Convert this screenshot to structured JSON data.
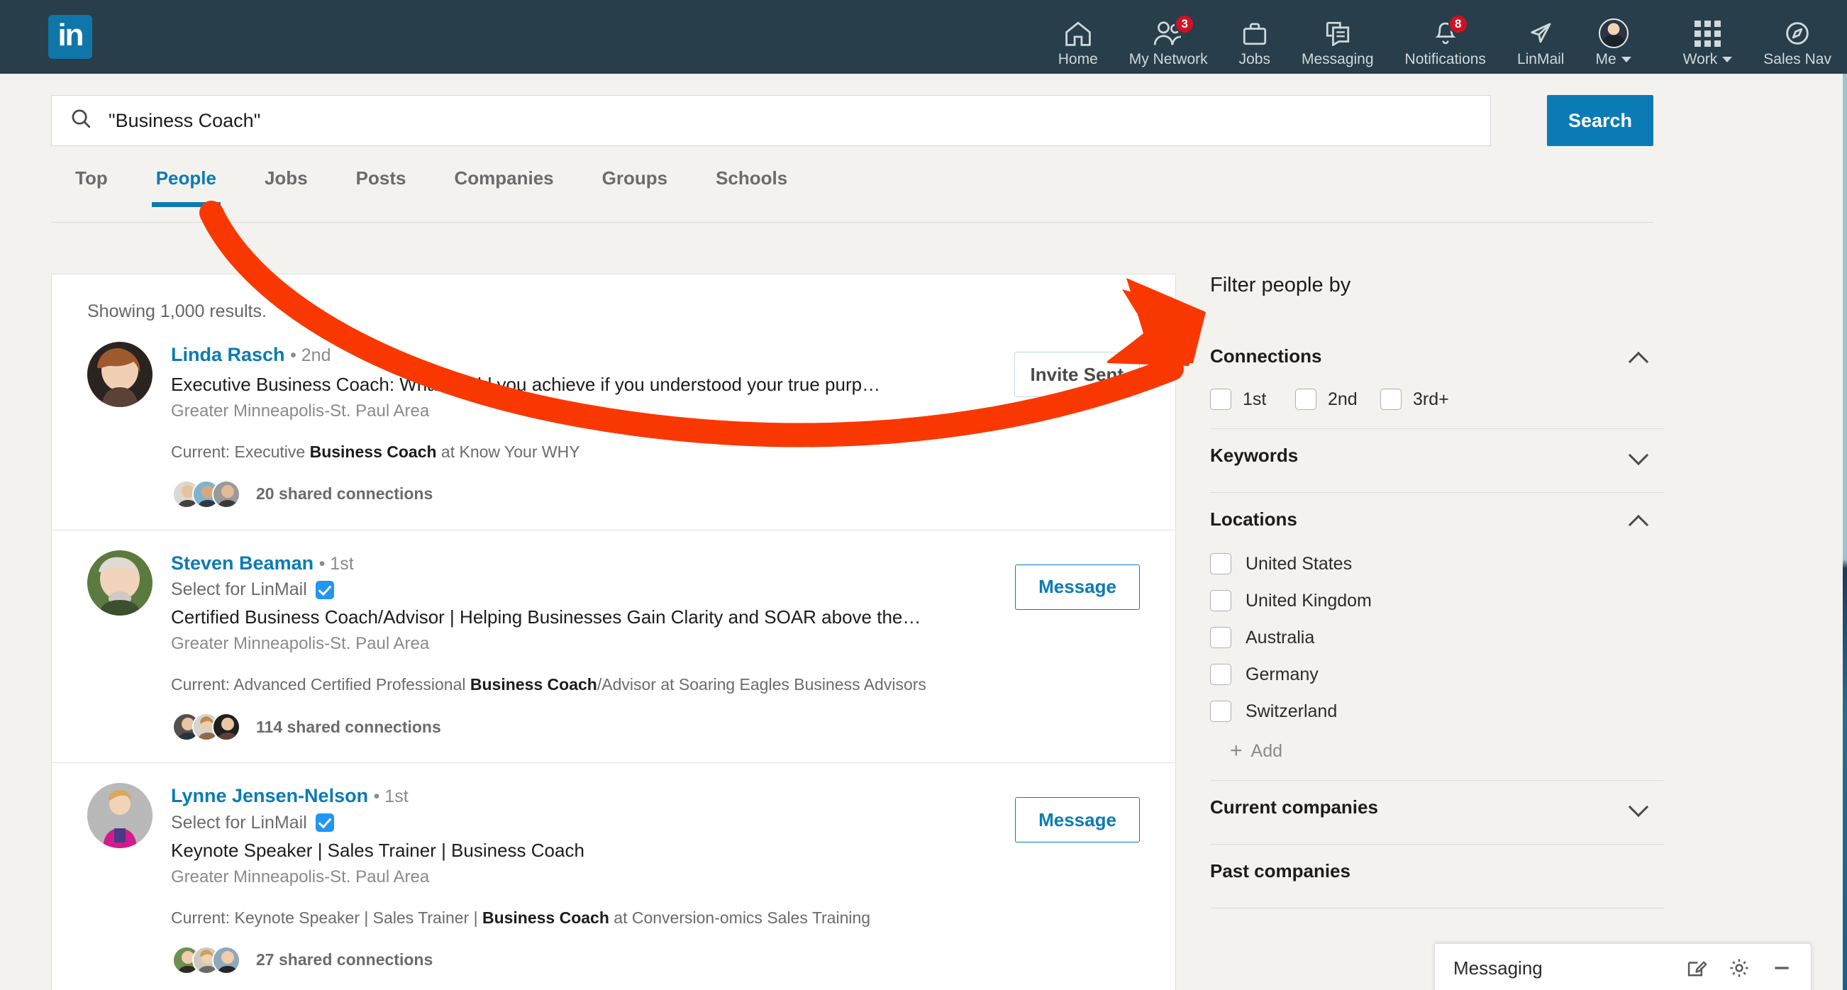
{
  "topnav": {
    "logo": "in",
    "items": [
      {
        "label": "Home",
        "icon": "home-icon",
        "badge": null
      },
      {
        "label": "My Network",
        "icon": "people-icon",
        "badge": "3"
      },
      {
        "label": "Jobs",
        "icon": "briefcase-icon",
        "badge": null
      },
      {
        "label": "Messaging",
        "icon": "message-icon",
        "badge": null
      },
      {
        "label": "Notifications",
        "icon": "bell-icon",
        "badge": "8"
      },
      {
        "label": "LinMail",
        "icon": "paper-plane-icon",
        "badge": null
      },
      {
        "label": "Me",
        "icon": "avatar",
        "badge": null
      },
      {
        "label": "Work",
        "icon": "grid-icon",
        "badge": null
      },
      {
        "label": "Sales Nav",
        "icon": "compass-icon",
        "badge": null
      }
    ],
    "background_color": "#283e4a"
  },
  "search": {
    "value": "\"Business Coach\"",
    "placeholder": "Search",
    "icon": "search-icon",
    "button_label": "Search",
    "button_color": "#0b7bb5"
  },
  "tabs": [
    {
      "label": "Top",
      "active": false
    },
    {
      "label": "People",
      "active": true
    },
    {
      "label": "Jobs",
      "active": false
    },
    {
      "label": "Posts",
      "active": false
    },
    {
      "label": "Companies",
      "active": false
    },
    {
      "label": "Groups",
      "active": false
    },
    {
      "label": "Schools",
      "active": false
    }
  ],
  "results": {
    "showing": "Showing 1,000 results.",
    "people": [
      {
        "name": "Linda Rasch",
        "degree": "• 2nd",
        "linmail_label": null,
        "linmail_checked": false,
        "headline": "Executive Business Coach: What could you achieve if you understood your true purp…",
        "location": "Greater Minneapolis-St. Paul Area",
        "current_prefix": "Current: Executive ",
        "current_bold": "Business Coach",
        "current_suffix": " at Know Your WHY",
        "shared": "20 shared connections",
        "action": "Invite Sent",
        "action_type": "invite"
      },
      {
        "name": "Steven Beaman",
        "degree": "• 1st",
        "linmail_label": "Select for LinMail",
        "linmail_checked": true,
        "headline": "Certified Business Coach/Advisor | Helping Businesses Gain Clarity and SOAR above the…",
        "location": "Greater Minneapolis-St. Paul Area",
        "current_prefix": "Current: Advanced Certified Professional ",
        "current_bold": "Business Coach",
        "current_suffix": "/Advisor at Soaring Eagles Business Advisors",
        "shared": "114 shared connections",
        "action": "Message",
        "action_type": "message"
      },
      {
        "name": "Lynne Jensen-Nelson",
        "degree": "• 1st",
        "linmail_label": "Select for LinMail",
        "linmail_checked": true,
        "headline": "Keynote Speaker | Sales Trainer | Business Coach",
        "location": "Greater Minneapolis-St. Paul Area",
        "current_prefix": "Current: Keynote Speaker | Sales Trainer | ",
        "current_bold": "Business Coach",
        "current_suffix": " at Conversion-omics Sales Training",
        "shared": "27 shared connections",
        "action": "Message",
        "action_type": "message"
      }
    ]
  },
  "sidebar": {
    "title": "Filter people by",
    "connections": {
      "header": "Connections",
      "expanded": true,
      "options": [
        {
          "label": "1st",
          "checked": false
        },
        {
          "label": "2nd",
          "checked": false
        },
        {
          "label": "3rd+",
          "checked": false
        }
      ]
    },
    "keywords": {
      "header": "Keywords",
      "expanded": false
    },
    "locations": {
      "header": "Locations",
      "expanded": true,
      "options": [
        {
          "label": "United States",
          "checked": false
        },
        {
          "label": "United Kingdom",
          "checked": false
        },
        {
          "label": "Australia",
          "checked": false
        },
        {
          "label": "Germany",
          "checked": false
        },
        {
          "label": "Switzerland",
          "checked": false
        }
      ],
      "add_label": "Add"
    },
    "current_companies": {
      "header": "Current companies",
      "expanded": false
    },
    "past_companies": {
      "header": "Past companies",
      "expanded": false
    }
  },
  "messaging_widget": {
    "title": "Messaging",
    "compose_icon": "compose-icon",
    "settings_icon": "gear-icon",
    "minimize_icon": "minimize-icon"
  },
  "annotation": {
    "type": "arrow",
    "color": "#f93801",
    "points_to": "Filter people by"
  }
}
